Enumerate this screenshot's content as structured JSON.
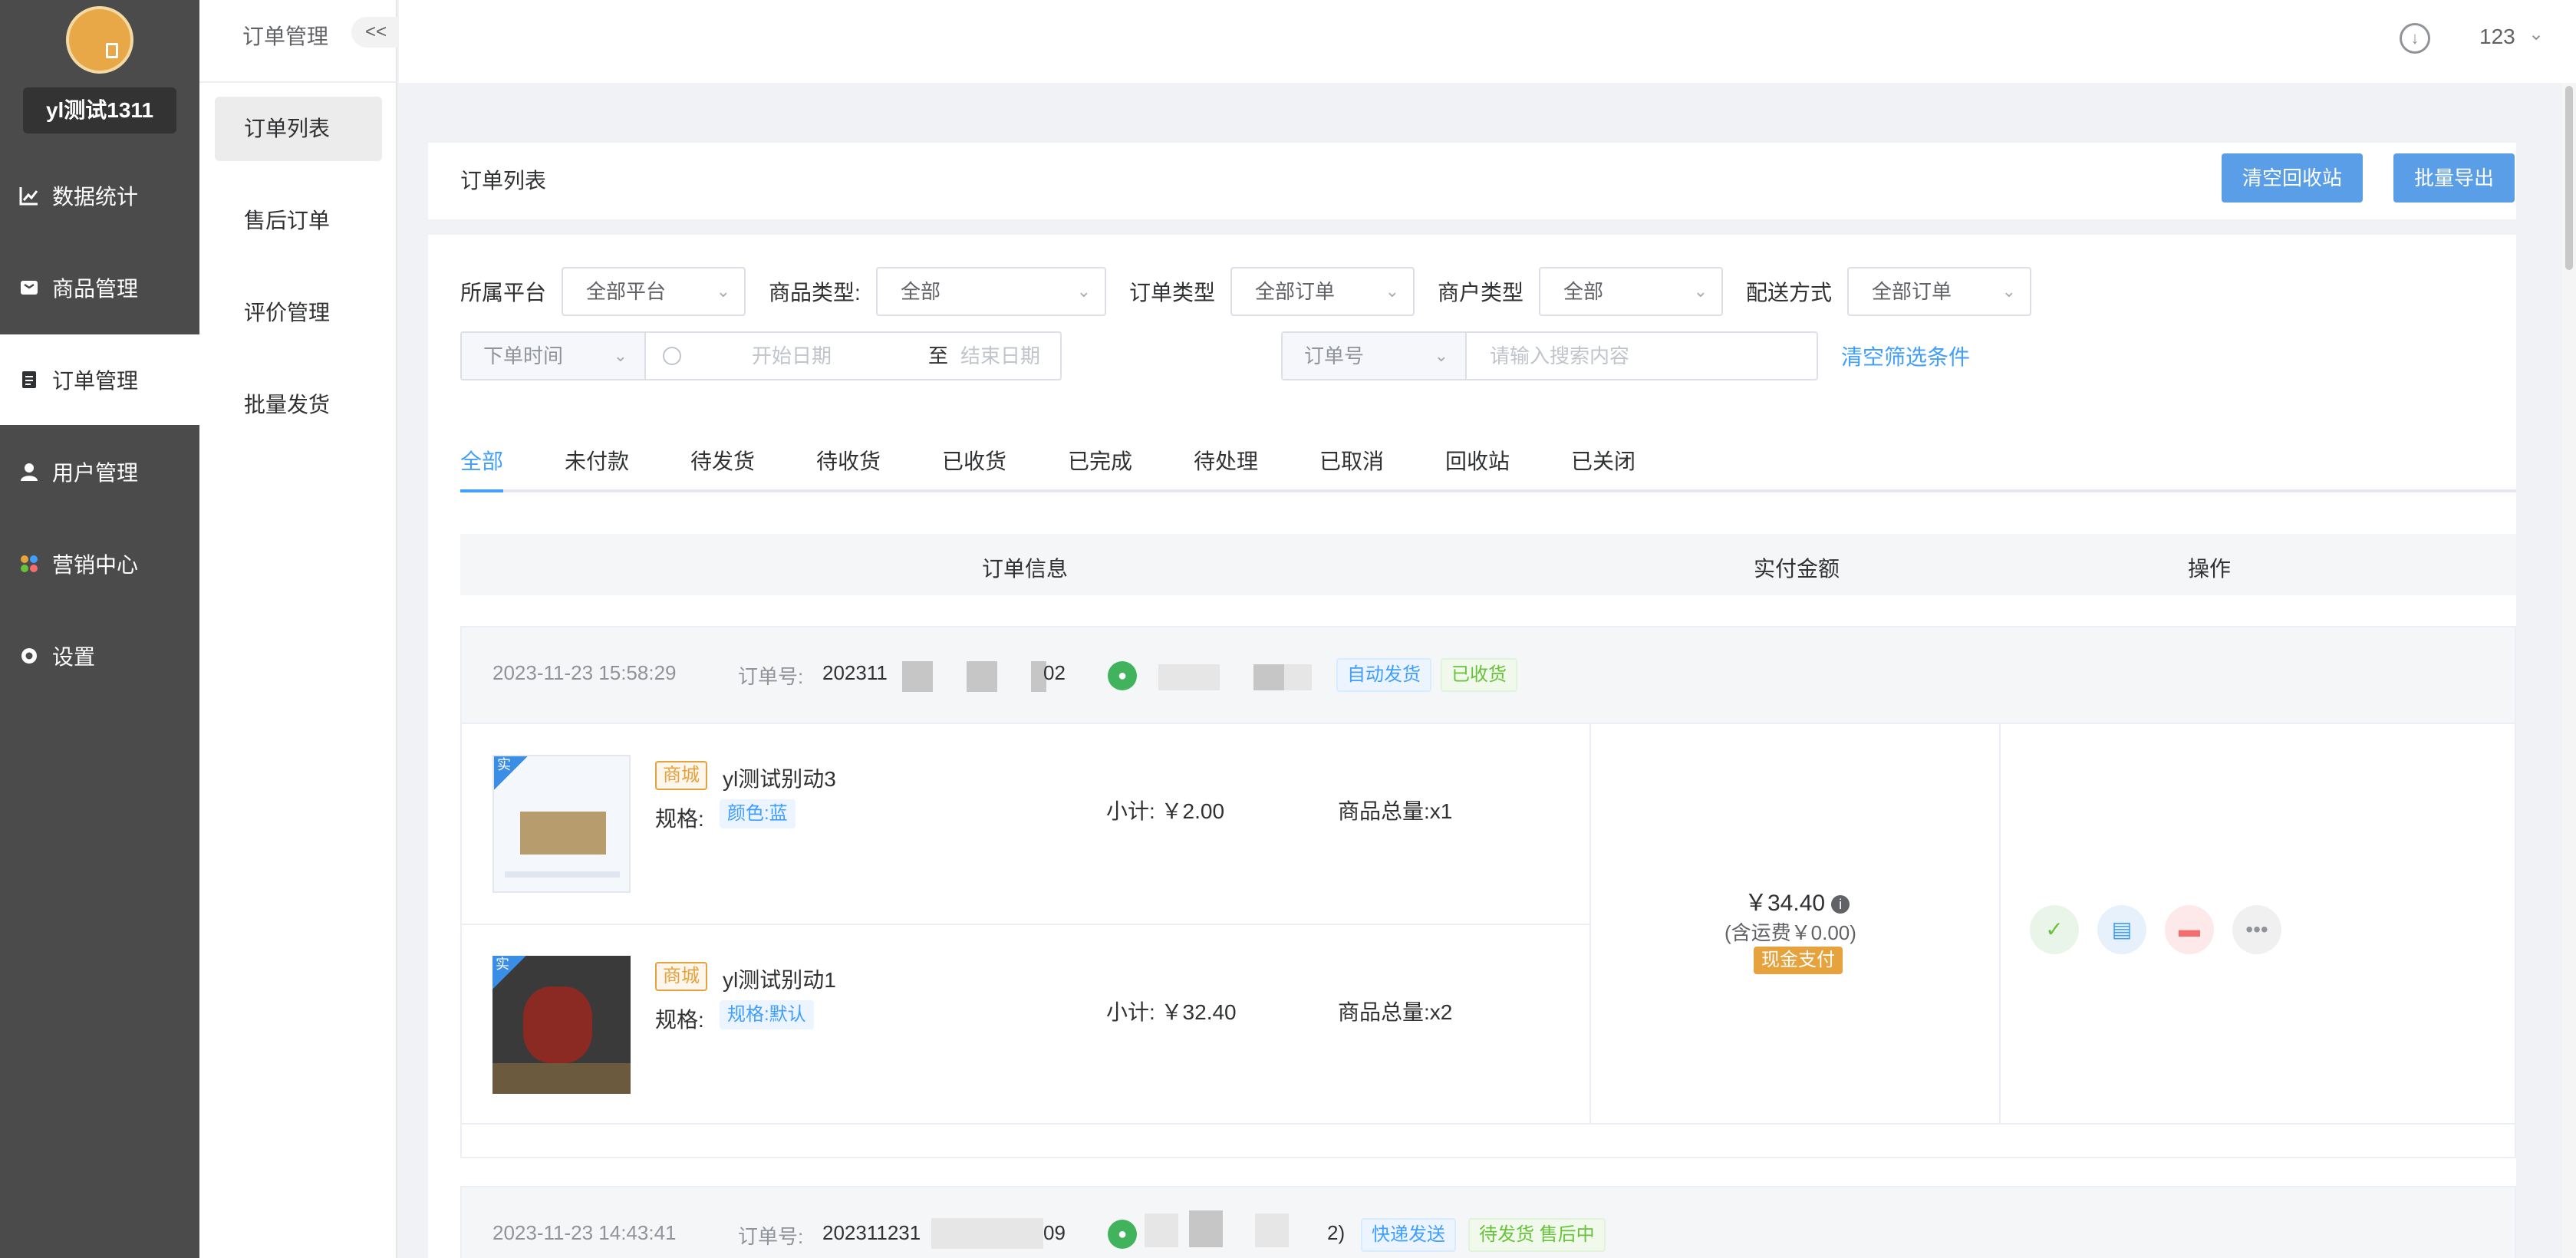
{
  "sidebar": {
    "shop_name": "yl测试1311",
    "items": [
      {
        "label": "数据统计",
        "icon": "chart-line-icon"
      },
      {
        "label": "商品管理",
        "icon": "product-box-icon"
      },
      {
        "label": "订单管理",
        "icon": "order-doc-icon"
      },
      {
        "label": "用户管理",
        "icon": "user-icon"
      },
      {
        "label": "营销中心",
        "icon": "marketing-icon"
      },
      {
        "label": "设置",
        "icon": "gear-icon"
      }
    ]
  },
  "submenu": {
    "title": "订单管理",
    "collapse_label": "<<",
    "items": [
      "订单列表",
      "售后订单",
      "评价管理",
      "批量发货"
    ]
  },
  "header": {
    "user": "123",
    "download_icon": "download-icon"
  },
  "page": {
    "title": "订单列表",
    "buttons": {
      "clear_recycle": "清空回收站",
      "batch_export": "批量导出"
    }
  },
  "filters": {
    "platform": {
      "label": "所属平台",
      "value": "全部平台"
    },
    "goods_type": {
      "label": "商品类型:",
      "value": "全部"
    },
    "order_type": {
      "label": "订单类型",
      "value": "全部订单"
    },
    "merchant_type": {
      "label": "商户类型",
      "value": "全部"
    },
    "delivery": {
      "label": "配送方式",
      "value": "全部订单"
    },
    "date_type": "下单时间",
    "date_start_placeholder": "开始日期",
    "date_sep": "至",
    "date_end_placeholder": "结束日期",
    "search_type": "订单号",
    "search_placeholder": "请输入搜索内容",
    "clear_label": "清空筛选条件"
  },
  "tabs": [
    "全部",
    "未付款",
    "待发货",
    "待收货",
    "已收货",
    "已完成",
    "待处理",
    "已取消",
    "回收站",
    "已关闭"
  ],
  "table": {
    "headers": {
      "info": "订单信息",
      "amount": "实付金额",
      "ops": "操作"
    }
  },
  "orders": [
    {
      "time": "2023-11-23 15:58:29",
      "no_label": "订单号:",
      "no_prefix": "202311",
      "no_suffix": "02",
      "tags": [
        "自动发货",
        "已收货"
      ],
      "products": [
        {
          "mall_tag": "商城",
          "name": "yl测试别动3",
          "spec_label": "规格:",
          "spec": "颜色:蓝",
          "subtotal": "小计: ￥2.00",
          "qty": "商品总量:x1"
        },
        {
          "mall_tag": "商城",
          "name": "yl测试别动1",
          "spec_label": "规格:",
          "spec": "规格:默认",
          "subtotal": "小计: ￥32.40",
          "qty": "商品总量:x2"
        }
      ],
      "amount": "￥34.40",
      "shipping": "(含运费￥0.00)",
      "payment": "现金支付"
    },
    {
      "time": "2023-11-23 14:43:41",
      "no_label": "订单号:",
      "no_prefix": "202311231",
      "no_suffix": "09",
      "suffix2": "2)",
      "tags": [
        "快递发送",
        "待发货 售后中"
      ]
    }
  ],
  "badges": {
    "product_badge": "实"
  }
}
